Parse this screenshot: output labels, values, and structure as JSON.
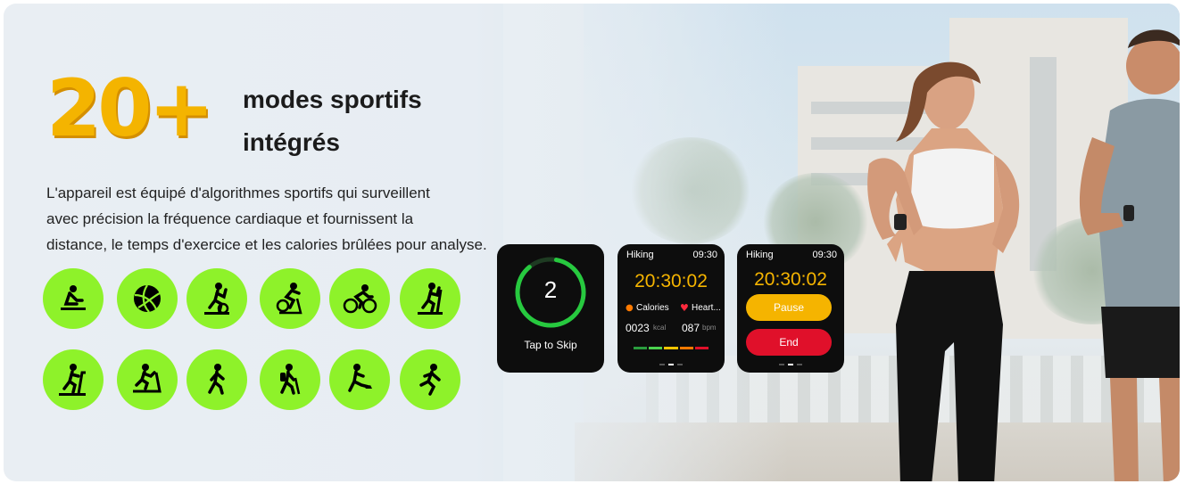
{
  "headline": {
    "number": "20+",
    "line1": "modes sportifs",
    "line2": "intégrés"
  },
  "description": {
    "line1": "L'appareil est équipé d'algorithmes sportifs qui surveillent",
    "line2": "avec précision la fréquence cardiaque et fournissent la",
    "line3": "distance, le temps d'exercice et les calories brûlées pour analyse."
  },
  "colors": {
    "accent_yellow": "#f4b400",
    "icon_green": "#8ef22a",
    "pause": "#f5b400",
    "end": "#e0102a"
  },
  "sport_icons": [
    "rowing-icon",
    "volleyball-icon",
    "elliptical-icon",
    "spinning-bike-icon",
    "cycling-icon",
    "stair-stepper-icon",
    "stepper-icon",
    "treadmill-icon",
    "walking-icon",
    "hiking-icon",
    "skating-icon",
    "running-icon"
  ],
  "watch1": {
    "countdown": "2",
    "caption": "Tap to Skip"
  },
  "watch2": {
    "mode": "Hiking",
    "clock": "09:30",
    "timer": "20:30:02",
    "metric1_label": "Calories",
    "metric1_value": "0023",
    "metric1_unit": "kcal",
    "metric2_label": "Heart...",
    "metric2_value": "087",
    "metric2_unit": "bpm"
  },
  "watch3": {
    "mode": "Hiking",
    "clock": "09:30",
    "timer": "20:30:02",
    "pause_label": "Pause",
    "end_label": "End"
  }
}
